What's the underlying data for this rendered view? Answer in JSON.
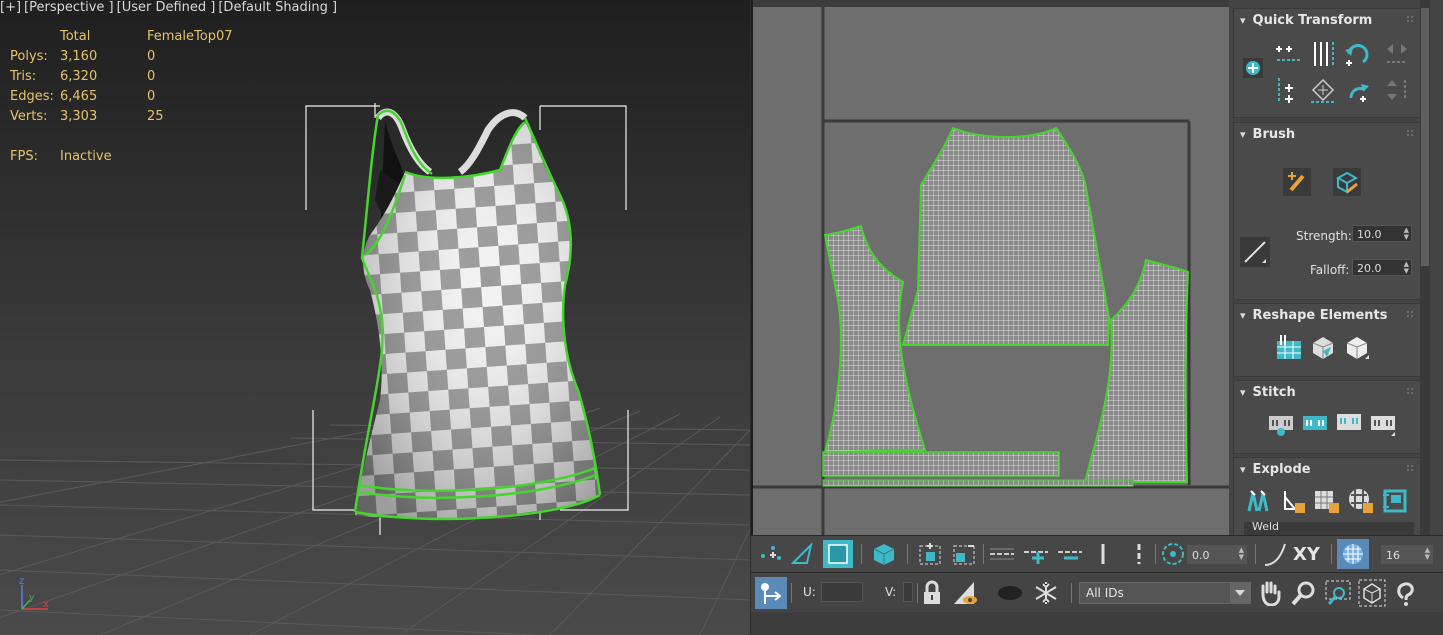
{
  "viewport": {
    "label_parts": [
      "[+]",
      "[Perspective ]",
      "[User Defined ]",
      "[Default Shading ]"
    ],
    "stats": {
      "header": [
        "",
        "Total",
        "FemaleTop07"
      ],
      "rows": [
        {
          "label": "Polys:",
          "total": "3,160",
          "selected": "0"
        },
        {
          "label": "Tris:",
          "total": "6,320",
          "selected": "0"
        },
        {
          "label": "Edges:",
          "total": "6,465",
          "selected": "0"
        },
        {
          "label": "Verts:",
          "total": "3,303",
          "selected": "25"
        }
      ],
      "fps_label": "FPS:",
      "fps_value": "Inactive"
    },
    "axis": {
      "x": "x",
      "y": "y",
      "z": "z"
    }
  },
  "panel": {
    "quick_transform": {
      "title": "Quick Transform"
    },
    "brush": {
      "title": "Brush",
      "strength_label": "Strength:",
      "strength_value": "10.0",
      "falloff_label": "Falloff:",
      "falloff_value": "20.0"
    },
    "reshape": {
      "title": "Reshape Elements"
    },
    "stitch": {
      "title": "Stitch"
    },
    "explode": {
      "title": "Explode",
      "weld_label": "Weld"
    }
  },
  "toolbar": {
    "spinner_value": "0.0",
    "xy_label": "XY",
    "grid_value": "16",
    "u_label": "U:",
    "v_label": "V:",
    "u_value": "",
    "v_value": "",
    "ids_value": "All IDs"
  },
  "colors": {
    "selection_green": "#44d62c",
    "accent_cyan": "#3fb8c8",
    "stat_yellow": "#e6c36a"
  }
}
